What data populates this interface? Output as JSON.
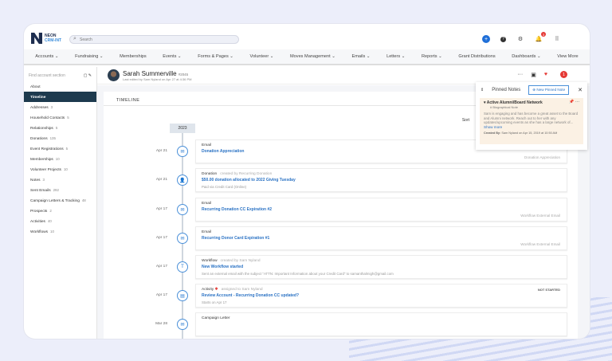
{
  "app": {
    "logo_line1": "NEON",
    "logo_line2": "CRM-INT",
    "search_placeholder": "Search",
    "notif_count": "3"
  },
  "nav": [
    "Accounts ⌄",
    "Fundraising ⌄",
    "Memberships",
    "Events ⌄",
    "Forms & Pages ⌄",
    "Volunteer ⌄",
    "Moves Management ⌄",
    "Emails ⌄",
    "Letters ⌄",
    "Reports ⌄",
    "Grant Distributions",
    "Dashboards ⌄",
    "View More"
  ],
  "sidebar": {
    "search_placeholder": "Find account section",
    "items": [
      {
        "label": "About",
        "count": ""
      },
      {
        "label": "Timeline",
        "count": ""
      },
      {
        "label": "Addresses",
        "count": "3"
      },
      {
        "label": "Household Contacts",
        "count": "5"
      },
      {
        "label": "Relationships",
        "count": "5"
      },
      {
        "label": "Donations",
        "count": "135"
      },
      {
        "label": "Event Registrations",
        "count": "5"
      },
      {
        "label": "Memberships",
        "count": "10"
      },
      {
        "label": "Volunteer Projects",
        "count": "10"
      },
      {
        "label": "Notes",
        "count": "3"
      },
      {
        "label": "Sent Emails",
        "count": "292"
      },
      {
        "label": "Campaign Letters & Tracking",
        "count": "48"
      },
      {
        "label": "Prospects",
        "count": "2"
      },
      {
        "label": "Activities",
        "count": "40"
      },
      {
        "label": "Workflows",
        "count": "10"
      }
    ]
  },
  "profile": {
    "name": "Sarah Summerville",
    "id": "#2045",
    "edited": "Last edited by Sam Nyland on Apr 27 at 4:36 PM",
    "alert_count": "1"
  },
  "timeline": {
    "heading": "TIMELINE",
    "sort": "Sort",
    "year": "2023",
    "entries": [
      {
        "date": "Apr 21",
        "icon": "email-icon",
        "glyph": "✉",
        "type": "Email",
        "meta": "",
        "title": "Donation Appreciation",
        "sub": "",
        "tag": "Donation Appreciation",
        "status": ""
      },
      {
        "date": "Apr 21",
        "icon": "donation-icon",
        "glyph": "👤",
        "type": "Donation",
        "meta": "created by Recurring Donation",
        "title": "$50.00 donation allocated to 2022 Giving Tuesday",
        "sub": "Paid via Credit Card (Online)",
        "tag": "",
        "status": ""
      },
      {
        "date": "Apr 17",
        "icon": "email-icon",
        "glyph": "✉",
        "type": "Email",
        "meta": "",
        "title": "Recurring Donation CC Expiration #2",
        "sub": "",
        "tag": "Workflow External Email",
        "status": ""
      },
      {
        "date": "Apr 17",
        "icon": "email-icon",
        "glyph": "✉",
        "type": "Email",
        "meta": "",
        "title": "Recurring Donor Card Expiration #1",
        "sub": "",
        "tag": "Workflow External Email",
        "status": ""
      },
      {
        "date": "Apr 17",
        "icon": "workflow-icon",
        "glyph": "T",
        "type": "Workflow",
        "meta": "created by Sam Nyland",
        "title": "New Workflow started",
        "sub": "Sent an external email with the subject \"ATTN: Important Information about your Credit Card\" to samanthalmigh@gmail.com",
        "tag": "",
        "status": ""
      },
      {
        "date": "Apr 17",
        "icon": "activity-icon",
        "glyph": "▤",
        "type": "Activity",
        "meta": "assigned to Sam Nyland",
        "title": "Review Account - Recurring Donation CC updated?",
        "sub": "Starts on Apr 17",
        "tag": "",
        "status": "NOT STARTED"
      },
      {
        "date": "Mar 28",
        "icon": "letter-icon",
        "glyph": "✉",
        "type": "Campaign Letter",
        "meta": "",
        "title": "",
        "sub": "",
        "tag": "",
        "status": ""
      }
    ]
  },
  "pinned": {
    "title": "Pinned Notes",
    "new_button": "New Pinned Note",
    "note_title": "Active Alumni/Board Network",
    "note_type": "Biographical Note",
    "note_body": "Sam is engaging and has become a great asset to the Board and Alumni network. Reach out to her with any updates/upcoming events as she has a large network of...",
    "show_more": "Show more",
    "created_label": "Created By:",
    "created": "Sam Nyland on Apr 15, 2019 at 10:50 AM"
  }
}
